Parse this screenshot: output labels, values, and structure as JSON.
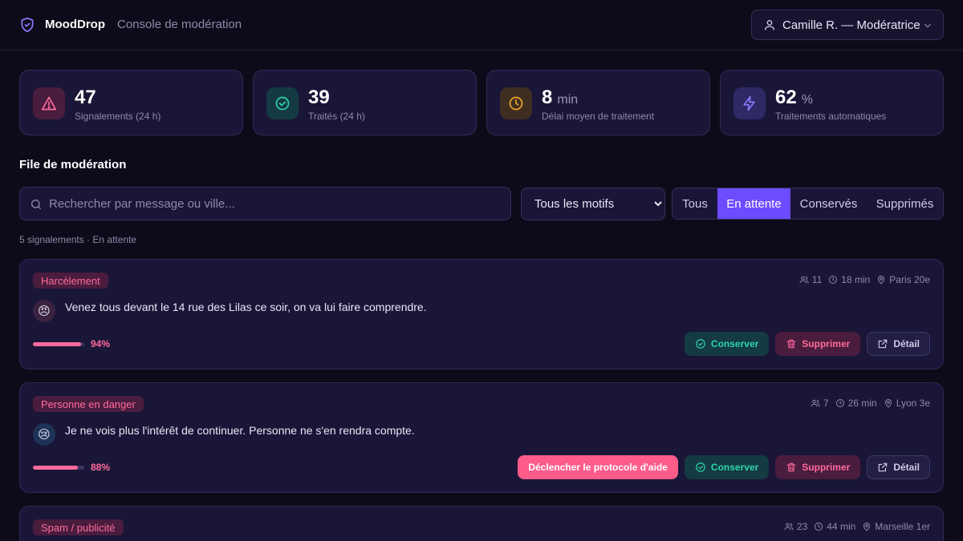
{
  "header": {
    "brand": "MoodDrop",
    "subtitle": "Console de modération",
    "user": "Camille R. — Modératrice"
  },
  "stats": [
    {
      "value": "47",
      "unit": "",
      "label": "Signalements (24 h)",
      "icon": "alert-triangle-icon",
      "color": "#ff6b9d"
    },
    {
      "value": "39",
      "unit": "",
      "label": "Traités (24 h)",
      "icon": "check-circle-icon",
      "color": "#2dd4aa"
    },
    {
      "value": "8",
      "unit": "min",
      "label": "Délai moyen de traitement",
      "icon": "clock-icon",
      "color": "#f5a623"
    },
    {
      "value": "62",
      "unit": "%",
      "label": "Traitements automatiques",
      "icon": "lightning-icon",
      "color": "#8b7bff"
    }
  ],
  "queue": {
    "title": "File de modération",
    "search_placeholder": "Rechercher par message ou ville...",
    "motif_selected": "Tous les motifs",
    "filters": [
      "Tous",
      "En attente",
      "Conservés",
      "Supprimés"
    ],
    "active_filter": "En attente",
    "count_text": "5 signalements · En attente"
  },
  "actions": {
    "keep": "Conserver",
    "delete": "Supprimer",
    "detail": "Détail",
    "help": "Déclencher le protocole d'aide"
  },
  "reports": [
    {
      "tag": "Harcèlement",
      "reporters": "11",
      "time": "18 min",
      "city": "Paris 20e",
      "emoji": "😠",
      "message": "Venez tous devant le 14 rue des Lilas ce soir, on va lui faire comprendre.",
      "score": 94,
      "score_text": "94%"
    },
    {
      "tag": "Personne en danger",
      "reporters": "7",
      "time": "26 min",
      "city": "Lyon 3e",
      "emoji": "😢",
      "message": "Je ne vois plus l'intérêt de continuer. Personne ne s'en rendra compte.",
      "score": 88,
      "score_text": "88%"
    },
    {
      "tag": "Spam / publicité",
      "reporters": "23",
      "time": "44 min",
      "city": "Marseille 1er"
    }
  ]
}
